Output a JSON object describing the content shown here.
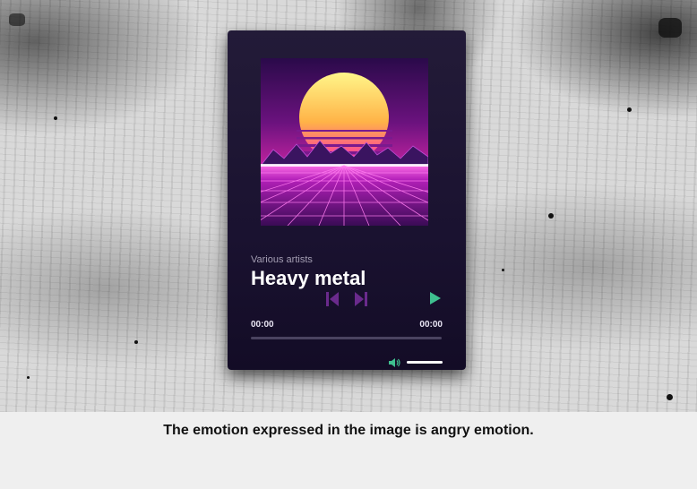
{
  "player": {
    "artist": "Various artists",
    "title": "Heavy metal",
    "current_time": "00:00",
    "duration": "00:00",
    "progress": 0.0,
    "volume": 1.0,
    "cover_art": "synthwave-sunset-grid",
    "icons": {
      "previous": "skip-previous-icon",
      "next": "skip-next-icon",
      "play": "play-icon",
      "volume": "volume-icon"
    },
    "colors": {
      "card_bg": "#1a1230",
      "control_purple": "#6a2a8c",
      "play_green": "#3fbf8f",
      "volume_green": "#3fbf8f"
    }
  },
  "caption": "The emotion expressed in the image is angry emotion."
}
